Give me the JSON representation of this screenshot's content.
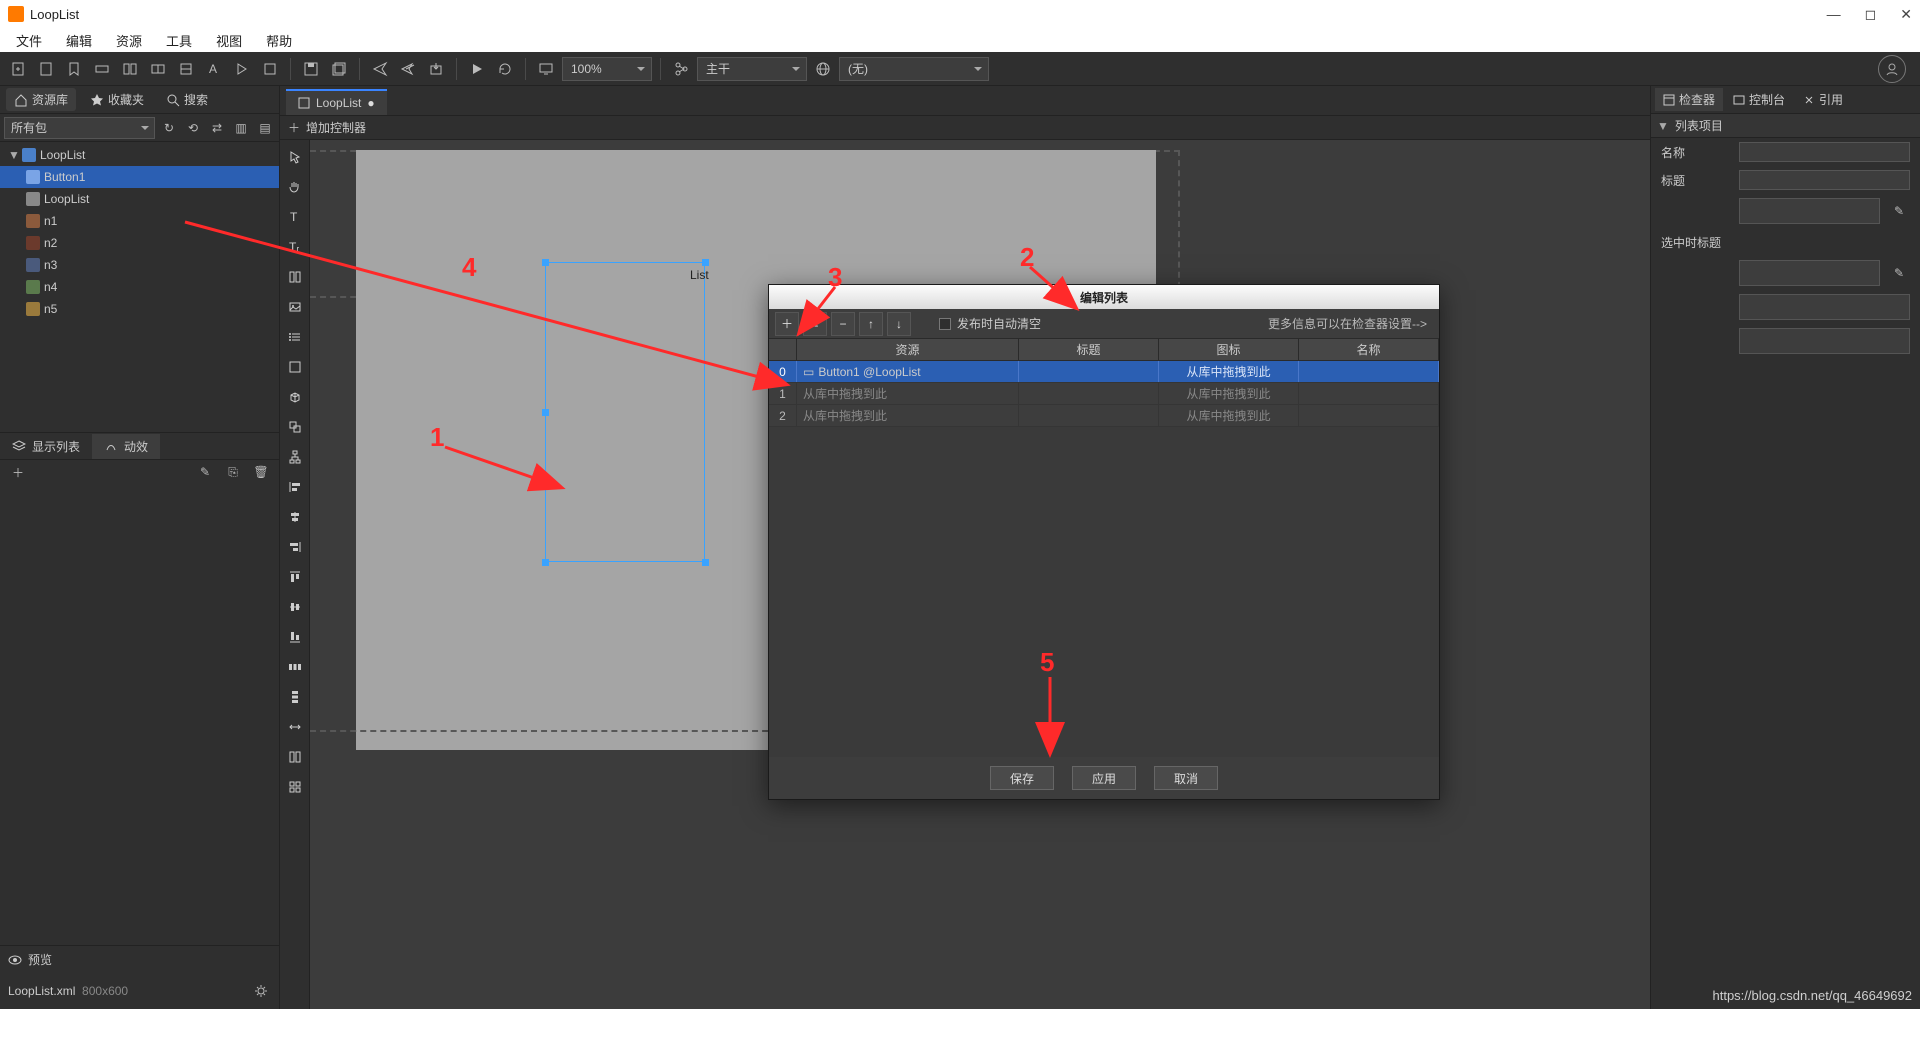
{
  "window": {
    "title": "LoopList"
  },
  "menubar": [
    "文件",
    "编辑",
    "资源",
    "工具",
    "视图",
    "帮助"
  ],
  "toolbar": {
    "zoom": "100%",
    "layout_label": "主干",
    "locale_label": "(无)"
  },
  "left": {
    "tabs": {
      "library": "资源库",
      "favorites": "收藏夹",
      "search": "搜索"
    },
    "package_filter": "所有包",
    "tree": {
      "root": "LoopList",
      "items": [
        {
          "label": "Button1",
          "selected": true
        },
        {
          "label": "LoopList"
        },
        {
          "label": "n1"
        },
        {
          "label": "n2"
        },
        {
          "label": "n3"
        },
        {
          "label": "n4"
        },
        {
          "label": "n5"
        }
      ]
    },
    "mid_tabs": {
      "display_list": "显示列表",
      "motion": "动效"
    },
    "preview": {
      "title": "预览",
      "file": "LoopList.xml",
      "size": "800x600"
    }
  },
  "center": {
    "doc_tab": "LoopList",
    "add_controller": "增加控制器",
    "selection_label": "List"
  },
  "right": {
    "tabs": {
      "inspector": "检查器",
      "console": "控制台",
      "refs": "引用"
    },
    "section": "列表项目",
    "props": {
      "name": "名称",
      "title": "标题",
      "selected_title": "选中时标题"
    }
  },
  "dialog": {
    "title": "编辑列表",
    "auto_clear": "发布时自动清空",
    "hint": "更多信息可以在检查器设置-->",
    "cols": {
      "resource": "资源",
      "title": "标题",
      "icon": "图标",
      "name": "名称"
    },
    "rows": [
      {
        "idx": "0",
        "resource": "Button1 @LoopList",
        "title": "",
        "icon": "从库中拖拽到此",
        "selected": true
      },
      {
        "idx": "1",
        "resource": "从库中拖拽到此",
        "title": "",
        "icon": "从库中拖拽到此"
      },
      {
        "idx": "2",
        "resource": "从库中拖拽到此",
        "title": "",
        "icon": "从库中拖拽到此"
      }
    ],
    "buttons": {
      "save": "保存",
      "apply": "应用",
      "cancel": "取消"
    }
  },
  "annotations": {
    "a1": "1",
    "a2": "2",
    "a3": "3",
    "a4": "4",
    "a5": "5"
  },
  "watermark": "https://blog.csdn.net/qq_46649692"
}
